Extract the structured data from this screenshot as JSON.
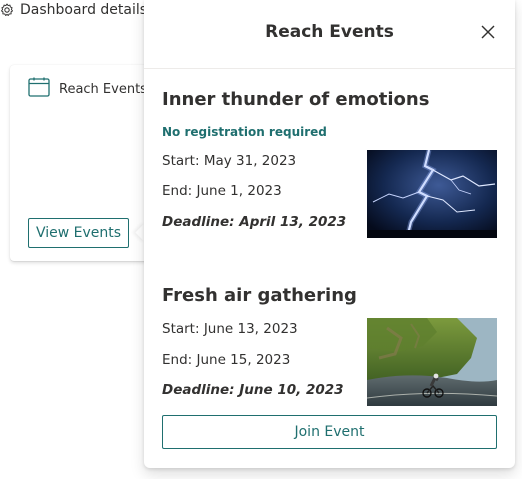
{
  "background": {
    "header_label": "Dashboard details",
    "card_title": "Reach Events",
    "view_button": "View Events"
  },
  "callout": {
    "title": "Reach Events",
    "join_button": "Join Event",
    "events": [
      {
        "title": "Inner thunder of emotions",
        "note": "No registration required",
        "start": "Start: May 31, 2023",
        "end": "End: June 1, 2023",
        "deadline": "Deadline: April 13, 2023"
      },
      {
        "title": "Fresh air gathering",
        "start": "Start: June 13, 2023",
        "end": "End: June 15, 2023",
        "deadline": "Deadline: June 10, 2023"
      }
    ]
  },
  "icons": [
    "gear-icon",
    "calendar-icon",
    "close-icon"
  ],
  "colors": {
    "accent": "#1f6f6f",
    "text": "#323130",
    "divider": "#edebe9"
  }
}
